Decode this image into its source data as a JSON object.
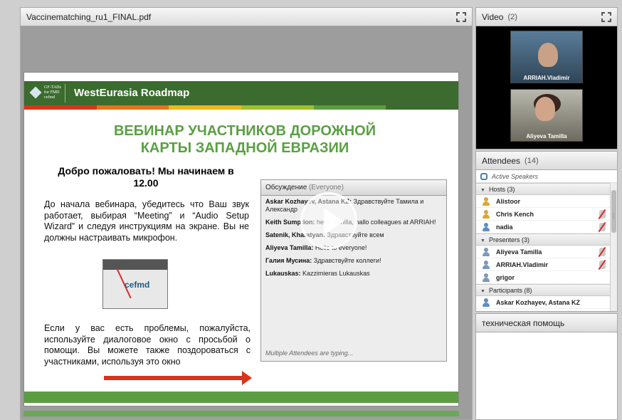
{
  "share_pod": {
    "title": "Vaccinematching_ru1_FINAL.pdf"
  },
  "slide": {
    "logo_lines": [
      "GF-TADs",
      "for FMD",
      "cefmd"
    ],
    "banner_title": "WestEurasia Roadmap",
    "title_line1": "ВЕБИНАР УЧАСТНИКОВ ДОРОЖНОЙ",
    "title_line2": "КАРТЫ ЗАПАДНОЙ ЕВРАЗИИ",
    "welcome_line1": "Добро пожаловать! Мы начинаем в",
    "welcome_line2": "12.00",
    "paragraph1": "До начала вебинара, убедитесь что Ваш звук работает, выбирая “Meeting” и “Audio Setup Wizard” и следуя инструкциям на экране. Вы не должны настраивать микрофон.",
    "paragraph2": "Если у вас есть проблемы, пожалуйста, используйте  диалоговое окно с просьбой о помощи. Вы можете также поздороваться с участниками, используя это окно",
    "thumb_logo": "cefmd",
    "stripe_colors": [
      "#d8341b",
      "#e5731c",
      "#ebb81c",
      "#9fbf2c",
      "#5c9c43",
      "#3b6b2e"
    ]
  },
  "embedded_chat": {
    "title": "Обсуждение",
    "subtitle": "(Everyone)",
    "messages": [
      {
        "sender": "Askar Kozhayev, Astana KZ:",
        "text": "Здравствуйте Тамила и Александр"
      },
      {
        "sender": "Keith Sumption:",
        "text": "hello Tamilla, hallo colleagues at ARRIAH!"
      },
      {
        "sender": "Satenik, Kharatyan:",
        "text": "Здравствуйте всем"
      },
      {
        "sender": "Aliyeva Tamilla:",
        "text": "Hello to everyone!"
      },
      {
        "sender": "Галия Мусина:",
        "text": "Здравствуйте коллеги!"
      },
      {
        "sender": "Lukauskas:",
        "text": "Kazzimieras Lukauskas"
      }
    ],
    "typing": "Multiple Attendees are typing..."
  },
  "video_pod": {
    "title": "Video",
    "count": "(2)",
    "cams": [
      {
        "name": "ARRIAH.Vladimir"
      },
      {
        "name": "Aliyeva Tamilla"
      }
    ]
  },
  "attendees_pod": {
    "title": "Attendees",
    "count": "(14)",
    "active_speakers": "Active Speakers",
    "hosts_label": "Hosts (3)",
    "hosts": [
      "Alistoor",
      "Chris Kench",
      "nadia"
    ],
    "presenters_label": "Presenters (3)",
    "presenters": [
      "Aliyeva Tamilla",
      "ARRIAH.Vladimir",
      "grigor"
    ],
    "participants_label": "Participants (8)",
    "participants": [
      "Askar Kozhayev, Astana KZ"
    ]
  },
  "help_pod": {
    "title": "техническая помощь"
  }
}
